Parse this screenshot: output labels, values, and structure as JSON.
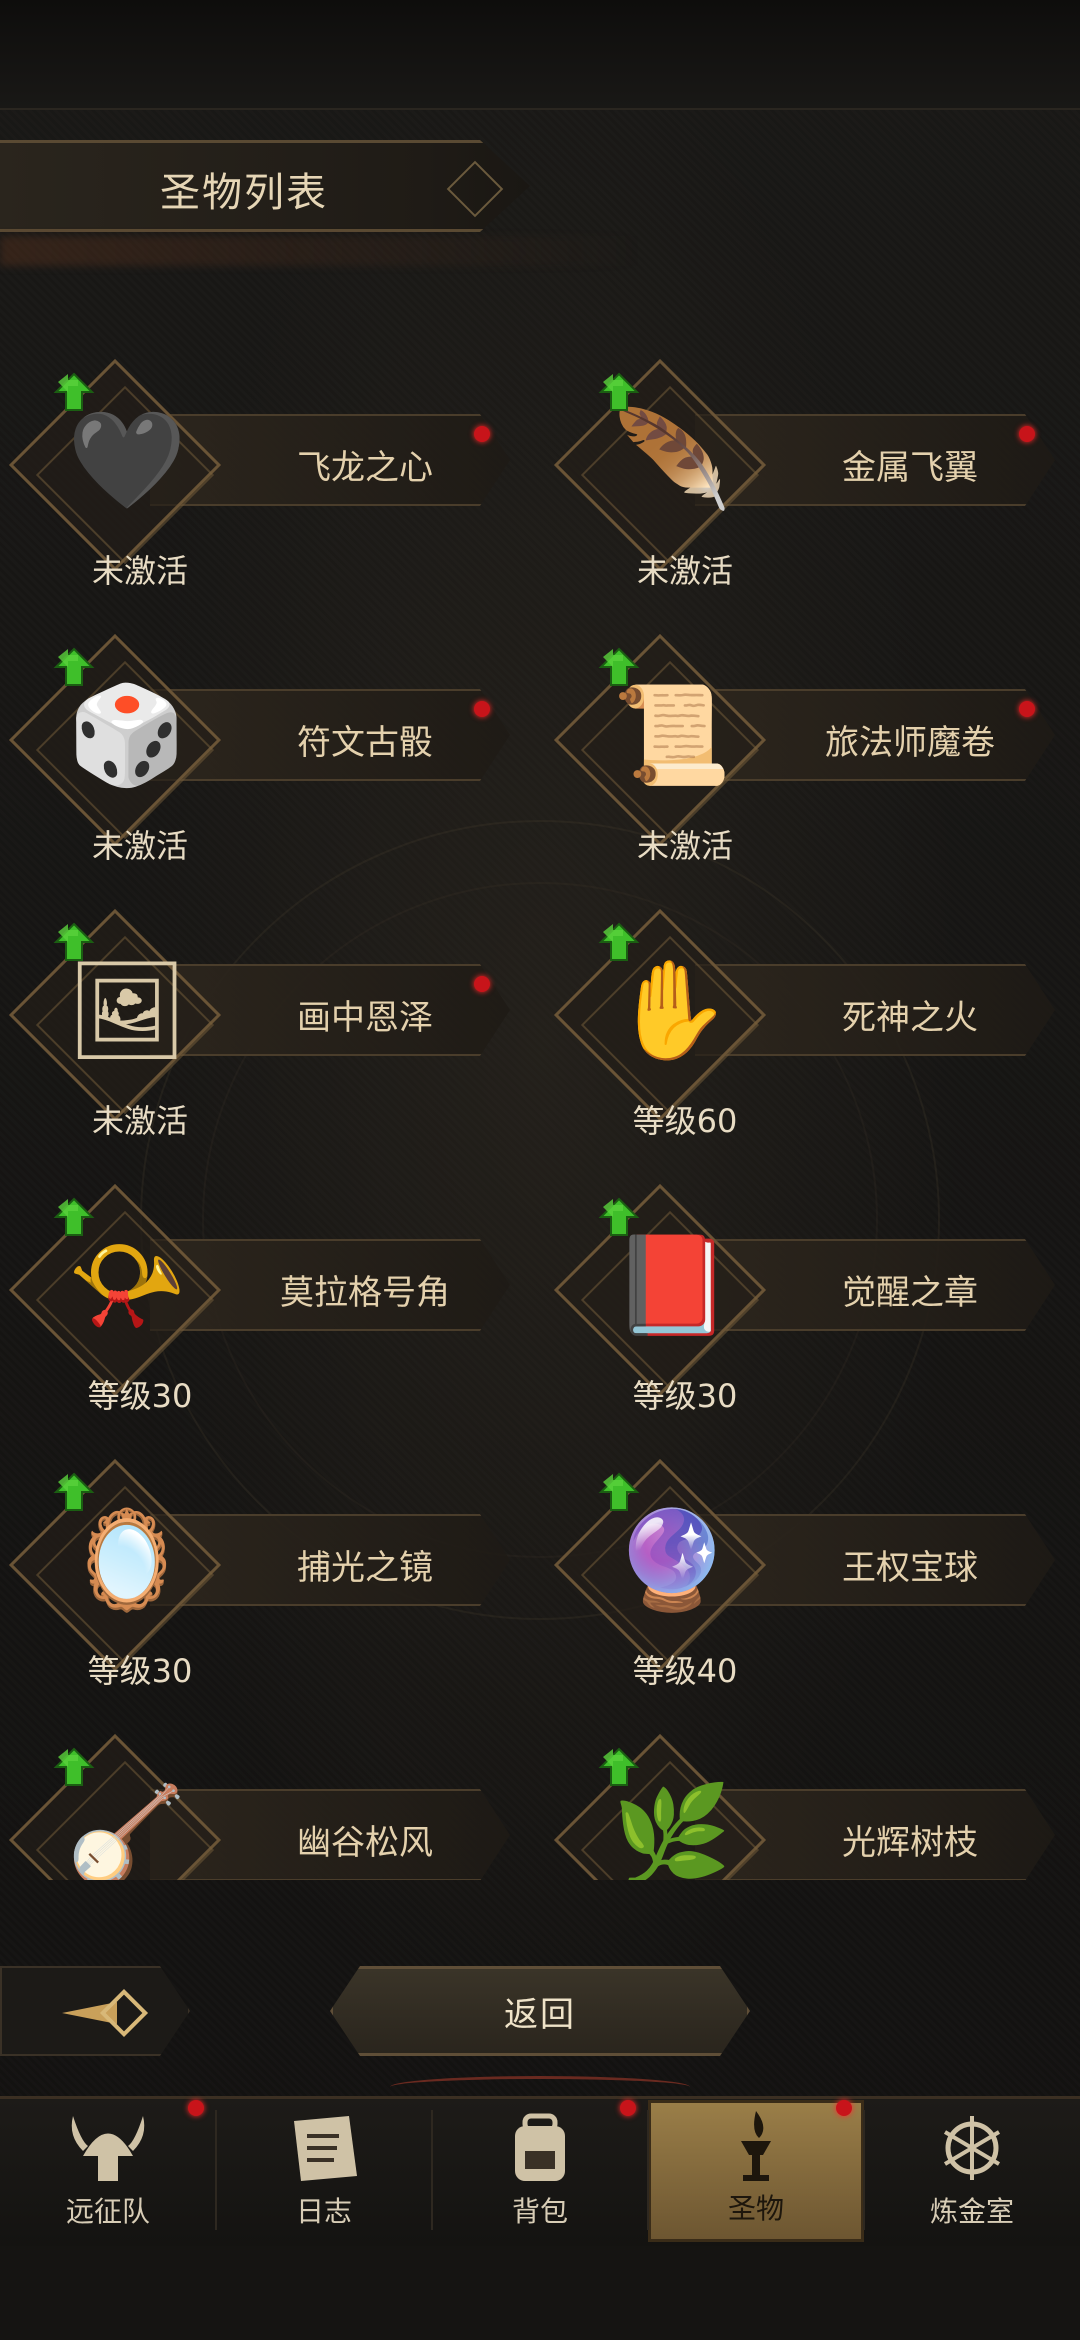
{
  "header": {
    "title": "圣物列表"
  },
  "relics": [
    {
      "name": "飞龙之心",
      "status": "未激活",
      "icon": "dragon-heart-icon",
      "glyph": "🖤",
      "has_dot": true
    },
    {
      "name": "金属飞翼",
      "status": "未激活",
      "icon": "metal-wing-icon",
      "glyph": "🪶",
      "has_dot": true
    },
    {
      "name": "符文古骰",
      "status": "未激活",
      "icon": "rune-dice-icon",
      "glyph": "🎲",
      "has_dot": true
    },
    {
      "name": "旅法师魔卷",
      "status": "未激活",
      "icon": "scroll-icon",
      "glyph": "📜",
      "has_dot": true
    },
    {
      "name": "画中恩泽",
      "status": "未激活",
      "icon": "painting-icon",
      "glyph": "🖼",
      "has_dot": true
    },
    {
      "name": "死神之火",
      "status": "等级60",
      "icon": "death-fire-hand-icon",
      "glyph": "✋",
      "has_dot": false
    },
    {
      "name": "莫拉格号角",
      "status": "等级30",
      "icon": "horn-icon",
      "glyph": "📯",
      "has_dot": false
    },
    {
      "name": "觉醒之章",
      "status": "等级30",
      "icon": "tome-icon",
      "glyph": "📕",
      "has_dot": false
    },
    {
      "name": "捕光之镜",
      "status": "等级30",
      "icon": "mirror-icon",
      "glyph": "🪞",
      "has_dot": false
    },
    {
      "name": "王权宝球",
      "status": "等级40",
      "icon": "scepter-orb-icon",
      "glyph": "🔮",
      "has_dot": false
    },
    {
      "name": "幽谷松风",
      "status": "",
      "icon": "lute-icon",
      "glyph": "🪕",
      "has_dot": false
    },
    {
      "name": "光辉树枝",
      "status": "",
      "icon": "branch-icon",
      "glyph": "🌿",
      "has_dot": false
    }
  ],
  "controls": {
    "return_label": "返回"
  },
  "tabs": [
    {
      "label": "远征队",
      "icon": "viking-helmet-icon",
      "has_dot": true,
      "active": false
    },
    {
      "label": "日志",
      "icon": "journal-icon",
      "has_dot": false,
      "active": false
    },
    {
      "label": "背包",
      "icon": "backpack-icon",
      "has_dot": true,
      "active": false
    },
    {
      "label": "圣物",
      "icon": "relic-torch-icon",
      "has_dot": true,
      "active": true
    },
    {
      "label": "炼金室",
      "icon": "alchemy-icon",
      "has_dot": false,
      "active": false
    }
  ],
  "colors": {
    "accent_gold": "#9a7e48",
    "notification_red": "#c8141a",
    "upgrade_green": "#3fbf2a"
  }
}
